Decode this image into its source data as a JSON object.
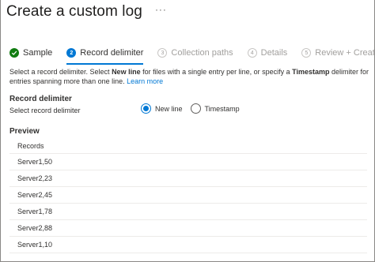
{
  "header": {
    "title": "Create a custom log",
    "more": "···"
  },
  "steps": [
    {
      "label": "Sample",
      "state": "done",
      "badge": ""
    },
    {
      "label": "Record delimiter",
      "state": "active",
      "badge": "2"
    },
    {
      "label": "Collection paths",
      "state": "disabled",
      "badge": "3"
    },
    {
      "label": "Details",
      "state": "disabled",
      "badge": "4"
    },
    {
      "label": "Review + Create",
      "state": "disabled",
      "badge": "5"
    }
  ],
  "description": {
    "p1": "Select a record delimiter. Select ",
    "b1": "New line",
    "p2": " for files with a single entry per line, or specify a ",
    "b2": "Timestamp",
    "p3": " delimiter for entries spanning more than one line. ",
    "link": "Learn more"
  },
  "record_delimiter": {
    "title": "Record delimiter",
    "subtitle": "Select record delimiter",
    "options": [
      {
        "label": "New line",
        "selected": true
      },
      {
        "label": "Timestamp",
        "selected": false
      }
    ]
  },
  "preview": {
    "title": "Preview",
    "column": "Records",
    "rows": [
      "Server1,50",
      "Server2,23",
      "Server2,45",
      "Server1,78",
      "Server2,88",
      "Server1,10"
    ]
  },
  "colors": {
    "accent": "#0078d4",
    "success": "#107c10"
  }
}
